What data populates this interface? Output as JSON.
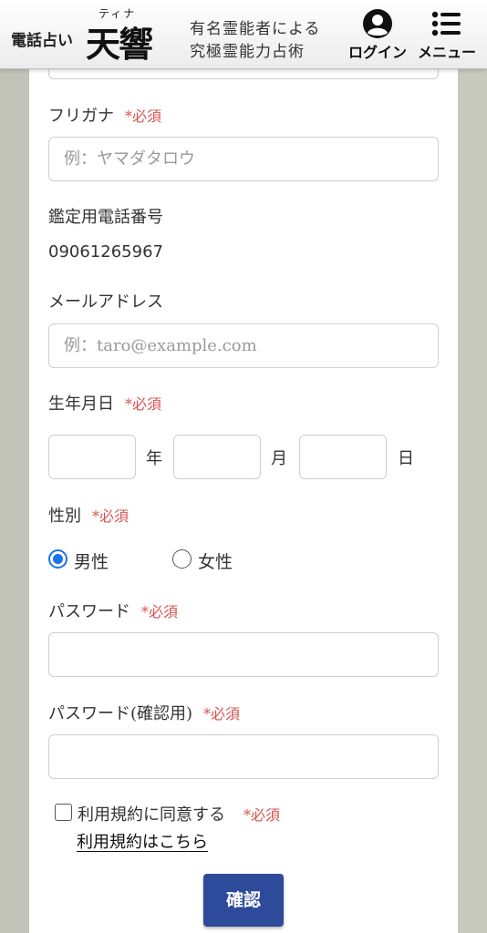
{
  "header": {
    "brand_prefix": "電話占い",
    "brand_ruby": "ティナ",
    "brand_name": "天響",
    "tagline_line1": "有名霊能者による",
    "tagline_line2": "究極霊能力占術",
    "login_label": "ログイン",
    "menu_label": "メニュー"
  },
  "form": {
    "required_mark": "*必須",
    "furigana_label": "フリガナ",
    "furigana_placeholder": "例：ヤマダタロウ",
    "phone_label": "鑑定用電話番号",
    "phone_value": "09061265967",
    "email_label": "メールアドレス",
    "email_placeholder": "例：taro@example.com",
    "birthday_label": "生年月日",
    "year_unit": "年",
    "month_unit": "月",
    "day_unit": "日",
    "gender_label": "性別",
    "gender_male": "男性",
    "gender_female": "女性",
    "gender_selected": "男性",
    "password_label": "パスワード",
    "password_confirm_label": "パスワード(確認用)",
    "terms_agree_label": "利用規約に同意する",
    "terms_link": "利用規約はこちら",
    "confirm_button": "確認"
  },
  "colors": {
    "required": "#d9534f",
    "radio_selected": "#1a73e8",
    "button_bg": "#2e4a9b"
  }
}
